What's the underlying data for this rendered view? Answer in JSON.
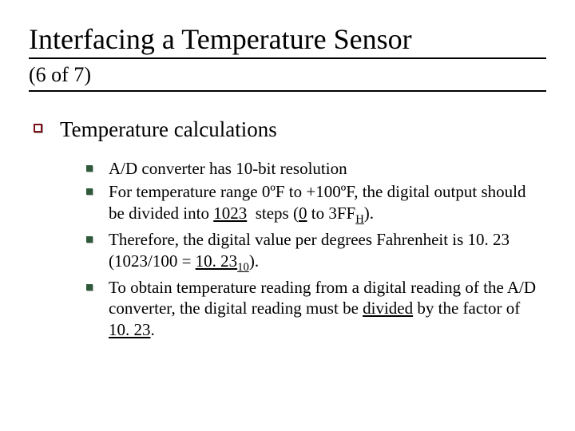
{
  "title": "Interfacing a Temperature Sensor",
  "subtitle": "(6 of 7)",
  "level1": "Temperature calculations",
  "items": [
    {
      "html": "A/D converter has 10-bit resolution"
    },
    {
      "html": "For temperature range 0ºF to +100ºF, the digital output should be divided into <span class='u'>1023</span>&nbsp;&nbsp;steps (<span class='u'>0</span> to 3FF<sub>H</sub>)."
    },
    {
      "html": "Therefore, the digital value per degrees Fahrenheit is 10. 23 (1023/100 = <span class='u'>10. 23</span><sub>10</sub>)."
    },
    {
      "html": "To obtain temperature reading from a digital reading of the A/D converter, the digital reading must be <span class='u'>divided</span> by the factor of <span class='u'>10. 23</span>."
    }
  ]
}
